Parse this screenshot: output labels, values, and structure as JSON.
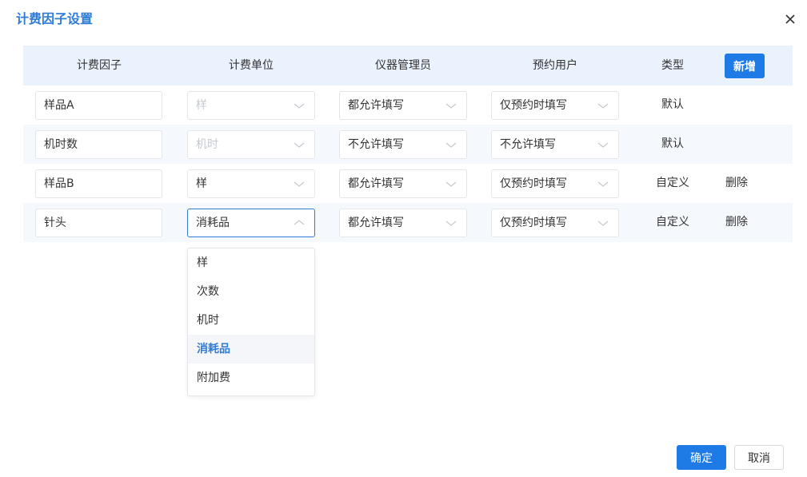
{
  "dialog": {
    "title": "计费因子设置",
    "close_icon": "close-icon"
  },
  "table": {
    "headers": [
      "计费因子",
      "计费单位",
      "仪器管理员",
      "预约用户",
      "类型"
    ],
    "add_label": "新增",
    "rows": [
      {
        "factor": "样品A",
        "unit": "样",
        "unit_disabled": true,
        "admin": "都允许填写",
        "user": "仅预约时填写",
        "type": "默认",
        "action": ""
      },
      {
        "factor": "机时数",
        "unit": "机时",
        "unit_disabled": true,
        "admin": "不允许填写",
        "user": "不允许填写",
        "type": "默认",
        "action": ""
      },
      {
        "factor": "样品B",
        "unit": "样",
        "unit_disabled": false,
        "admin": "都允许填写",
        "user": "仅预约时填写",
        "type": "自定义",
        "action": "删除"
      },
      {
        "factor": "针头",
        "unit": "消耗品",
        "unit_disabled": false,
        "admin": "都允许填写",
        "user": "仅预约时填写",
        "type": "自定义",
        "action": "删除"
      }
    ]
  },
  "dropdown": {
    "options": [
      "样",
      "次数",
      "机时",
      "消耗品",
      "附加费"
    ],
    "selected": "消耗品"
  },
  "footer": {
    "ok_label": "确定",
    "cancel_label": "取消"
  },
  "colors": {
    "accent": "#1e7be6",
    "title": "#2f7bd6",
    "header_bg": "#eaf2fd"
  }
}
